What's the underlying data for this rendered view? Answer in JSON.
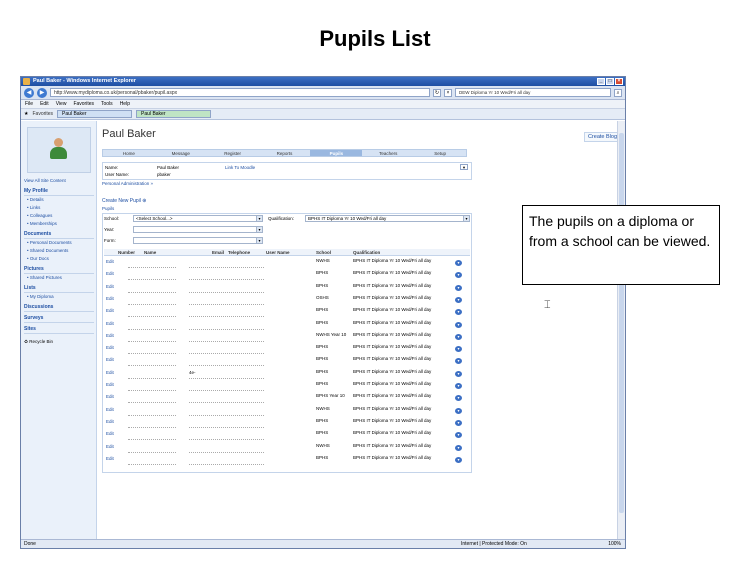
{
  "slide": {
    "title": "Pupils List",
    "callout": "The pupils on a diploma or from a school can be viewed."
  },
  "browser": {
    "window_title": "Paul Baker - Windows Internet Explorer",
    "url": "http://www.mydiploma.co.uk/personal/pbaker/pupil.aspx",
    "search_text": "DEW Diploma Yr 10 Wed/Fri all day",
    "menu": [
      "File",
      "Edit",
      "View",
      "Favorites",
      "Tools",
      "Help"
    ],
    "favorites_label": "Favorites",
    "tabs": [
      "Paul Baker",
      "Paul Baker"
    ],
    "status_left": "Done",
    "status_zone": "Internet | Protected Mode: On",
    "status_zoom": "100%"
  },
  "left_nav": {
    "view_all": "View All Site Content",
    "my_profile": "My Profile",
    "profile_items": [
      "Details",
      "Links",
      "Colleagues",
      "Memberships"
    ],
    "documents": "Documents",
    "document_items": [
      "Personal Documents",
      "Shared Documents",
      "Our Docs"
    ],
    "pictures": "Pictures",
    "picture_items": [
      "Shared Pictures"
    ],
    "lists": "Lists",
    "list_items": [
      "My Diploma"
    ],
    "discussions": "Discussions",
    "surveys": "Surveys",
    "sites": "Sites",
    "recycle_bin": "Recycle Bin"
  },
  "page": {
    "heading": "Paul Baker",
    "create_blog": "Create Blog",
    "top_tabs": [
      "Home",
      "Message",
      "Register",
      "Reports",
      "Pupils",
      "Teachers",
      "Setup"
    ],
    "selected_tab": "Pupils",
    "info": {
      "name_label": "Name:",
      "name_value": "Paul Baker",
      "user_label": "User Name:",
      "user_value": "pbaker",
      "moodle_link": "Link To Moodle"
    },
    "personal_admin": "Personal Administration",
    "create_pupil": "Create New Pupil",
    "pupils_label": "Pupils",
    "filters": {
      "school_label": "School:",
      "school_value": "<Select School...>",
      "qualification_label": "Qualification:",
      "qualification_value": "BPHS IT Diploma Yr 10 Wed/Fri all day",
      "year_label": "Year:",
      "form_label": "Form:"
    },
    "table": {
      "headers": [
        "Number",
        "Name",
        "Email",
        "Telephone",
        "User Name",
        "School",
        "Qualification"
      ],
      "rows": [
        {
          "edit": "Edit",
          "email": "",
          "school": "NWHS",
          "qualification": "BPHS IT Diploma Yr 10 Wed/Fri all day"
        },
        {
          "edit": "Edit",
          "email": "",
          "school": "BPHS",
          "qualification": "BPHS IT Diploma Yr 10 Wed/Fri all day"
        },
        {
          "edit": "Edit",
          "email": "",
          "school": "BPHS",
          "qualification": "BPHS IT Diploma Yr 10 Wed/Fri all day"
        },
        {
          "edit": "Edit",
          "email": "",
          "school": "OSHS",
          "qualification": "BPHS IT Diploma Yr 10 Wed/Fri all day"
        },
        {
          "edit": "Edit",
          "email": "",
          "school": "BPHS",
          "qualification": "BPHS IT Diploma Yr 10 Wed/Fri all day"
        },
        {
          "edit": "Edit",
          "email": "",
          "school": "BPHS",
          "qualification": "BPHS IT Diploma Yr 10 Wed/Fri all day"
        },
        {
          "edit": "Edit",
          "email": "",
          "school": "NWHS Year 10",
          "qualification": "BPHS IT Diploma Yr 10 Wed/Fri all day"
        },
        {
          "edit": "Edit",
          "email": "",
          "school": "BPHS",
          "qualification": "BPHS IT Diploma Yr 10 Wed/Fri all day"
        },
        {
          "edit": "Edit",
          "email": "",
          "school": "BPHS",
          "qualification": "BPHS IT Diploma Yr 10 Wed/Fri all day"
        },
        {
          "edit": "Edit",
          "email": "4e-",
          "school": "BPHS",
          "qualification": "BPHS IT Diploma Yr 10 Wed/Fri all day"
        },
        {
          "edit": "Edit",
          "email": "",
          "school": "BPHS",
          "qualification": "BPHS IT Diploma Yr 10 Wed/Fri all day"
        },
        {
          "edit": "Edit",
          "email": "",
          "school": "BPHS Year 10",
          "qualification": "BPHS IT Diploma Yr 10 Wed/Fri all day"
        },
        {
          "edit": "Edit",
          "email": "",
          "school": "NWHS",
          "qualification": "BPHS IT Diploma Yr 10 Wed/Fri all day"
        },
        {
          "edit": "Edit",
          "email": "",
          "school": "BPHS",
          "qualification": "BPHS IT Diploma Yr 10 Wed/Fri all day"
        },
        {
          "edit": "Edit",
          "email": "",
          "school": "BPHS",
          "qualification": "BPHS IT Diploma Yr 10 Wed/Fri all day"
        },
        {
          "edit": "Edit",
          "email": "",
          "school": "NWHS",
          "qualification": "BPHS IT Diploma Yr 10 Wed/Fri all day"
        },
        {
          "edit": "Edit",
          "email": "",
          "school": "BPHS",
          "qualification": "BPHS IT Diploma Yr 10 Wed/Fri all day"
        }
      ]
    }
  }
}
